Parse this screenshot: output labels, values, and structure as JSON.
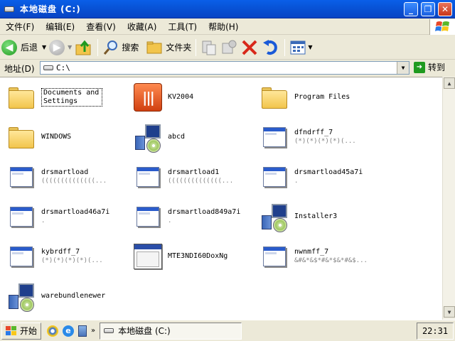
{
  "window": {
    "title": "本地磁盘  (C:)"
  },
  "menu": [
    {
      "label": "文件(F)"
    },
    {
      "label": "编辑(E)"
    },
    {
      "label": "查看(V)"
    },
    {
      "label": "收藏(A)"
    },
    {
      "label": "工具(T)"
    },
    {
      "label": "帮助(H)"
    }
  ],
  "toolbar": {
    "back": "后退",
    "search": "搜索",
    "folders": "文件夹"
  },
  "address": {
    "label": "地址(D)",
    "value": "C:\\",
    "go": "转到"
  },
  "files": [
    {
      "name": "Documents and Settings",
      "icon": "folder-icon",
      "sub": ""
    },
    {
      "name": "KV2004",
      "icon": "kv2004-icon",
      "sub": ""
    },
    {
      "name": "Program Files",
      "icon": "folder-icon",
      "sub": ""
    },
    {
      "name": "WINDOWS",
      "icon": "folder-icon",
      "sub": ""
    },
    {
      "name": "abcd",
      "icon": "installer-icon",
      "sub": ""
    },
    {
      "name": "dfndrff_7",
      "icon": "app-window-icon",
      "sub": "(*)(*)(*)(*)(..."
    },
    {
      "name": "drsmartload",
      "icon": "app-window-icon",
      "sub": "((((((((((((((..."
    },
    {
      "name": "drsmartload1",
      "icon": "app-window-icon",
      "sub": "((((((((((((((..."
    },
    {
      "name": "drsmartload45a7i",
      "icon": "app-window-icon",
      "sub": "."
    },
    {
      "name": "drsmartload46a7i",
      "icon": "app-window-icon",
      "sub": "."
    },
    {
      "name": "drsmartload849a7i",
      "icon": "app-window-icon",
      "sub": "."
    },
    {
      "name": "Installer3",
      "icon": "installer-icon",
      "sub": ""
    },
    {
      "name": "kybrdff_7",
      "icon": "app-window-icon",
      "sub": "(*)(*)(*)(*)(..."
    },
    {
      "name": "MTE3NDI60DoxNg",
      "icon": "window-icon",
      "sub": ""
    },
    {
      "name": "nwnmff_7",
      "icon": "app-window-icon",
      "sub": "&#&*&$*#&*$&*#&$..."
    },
    {
      "name": "warebundlenewer",
      "icon": "installer-icon",
      "sub": ""
    }
  ],
  "taskbar": {
    "start": "开始",
    "task": "本地磁盘  (C:)",
    "clock": "22:31"
  }
}
